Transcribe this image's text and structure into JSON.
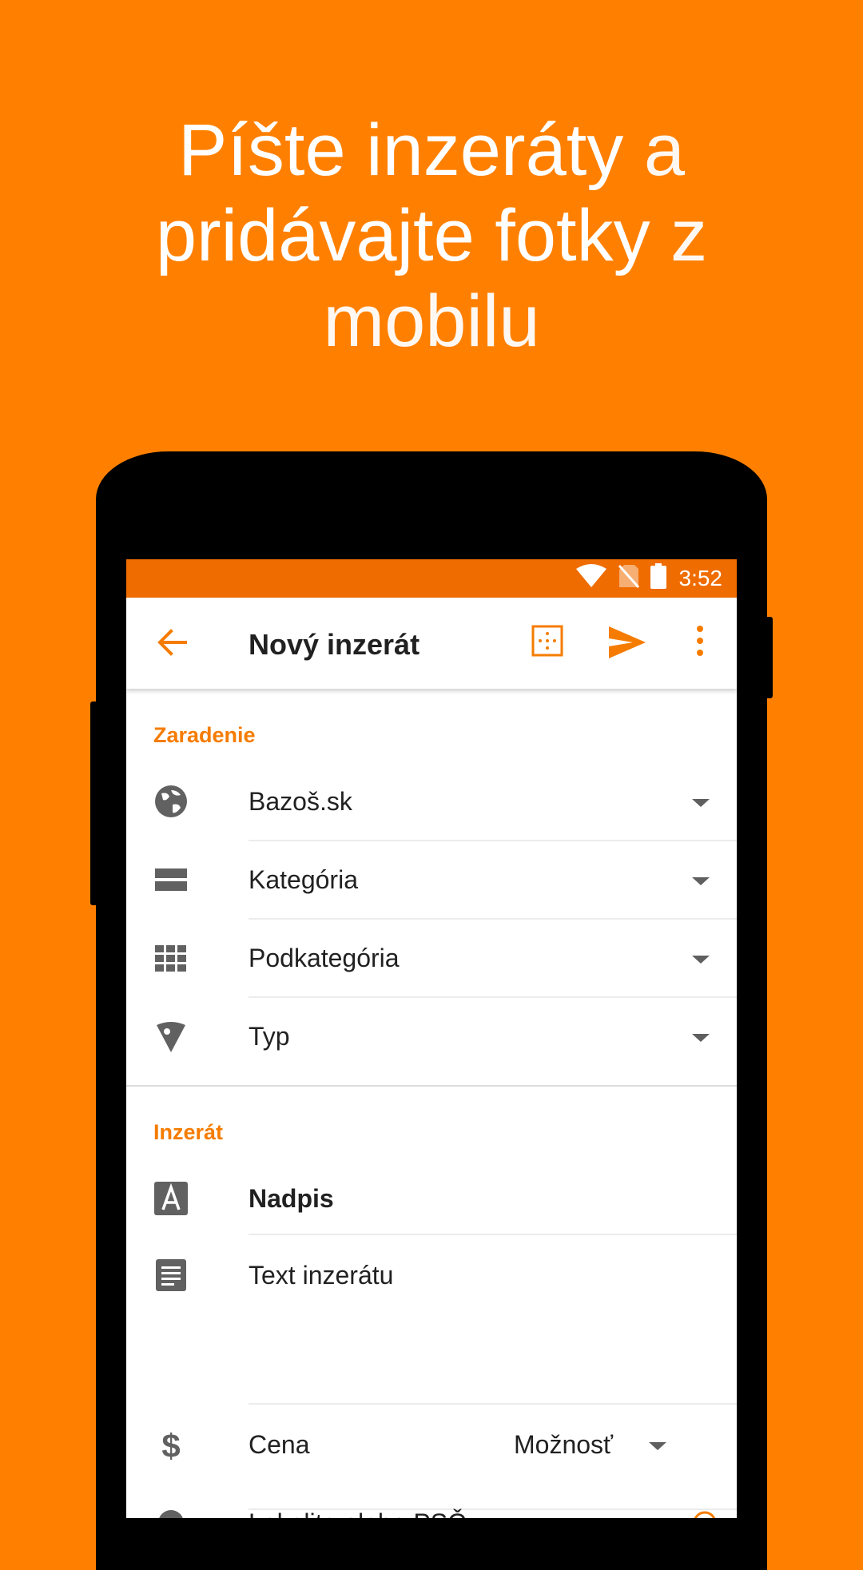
{
  "headline": {
    "line1_strong": "Píšte inzeráty",
    "line1_rest": "a",
    "line2_strong": "pridávajte fotky",
    "line2_rest": "z",
    "line3": "mobilu"
  },
  "statusbar": {
    "time": "3:52",
    "icons": [
      "wifi-icon",
      "no-sim-icon",
      "battery-icon"
    ]
  },
  "toolbar": {
    "title": "Nový inzerát",
    "actions": [
      "back-arrow-icon",
      "grid-select-icon",
      "send-icon",
      "more-vert-icon"
    ]
  },
  "sections": {
    "zaradenie": {
      "title": "Zaradenie",
      "rows": [
        {
          "label": "Bazoš.sk",
          "icon": "globe-icon"
        },
        {
          "label": "Kategória",
          "icon": "category-icon"
        },
        {
          "label": "Podkategória",
          "icon": "apps-grid-icon"
        },
        {
          "label": "Typ",
          "icon": "tag-icon"
        }
      ]
    },
    "inzerat": {
      "title": "Inzerát",
      "title_placeholder": "Nadpis",
      "text_placeholder": "Text inzerátu",
      "price_placeholder": "Cena",
      "price_option": "Možnosť",
      "location_placeholder": "Lokalita alebo PSČ"
    }
  },
  "colors": {
    "background": "#FF8000",
    "statusbar": "#EF6C00",
    "accent": "#F57C00"
  }
}
